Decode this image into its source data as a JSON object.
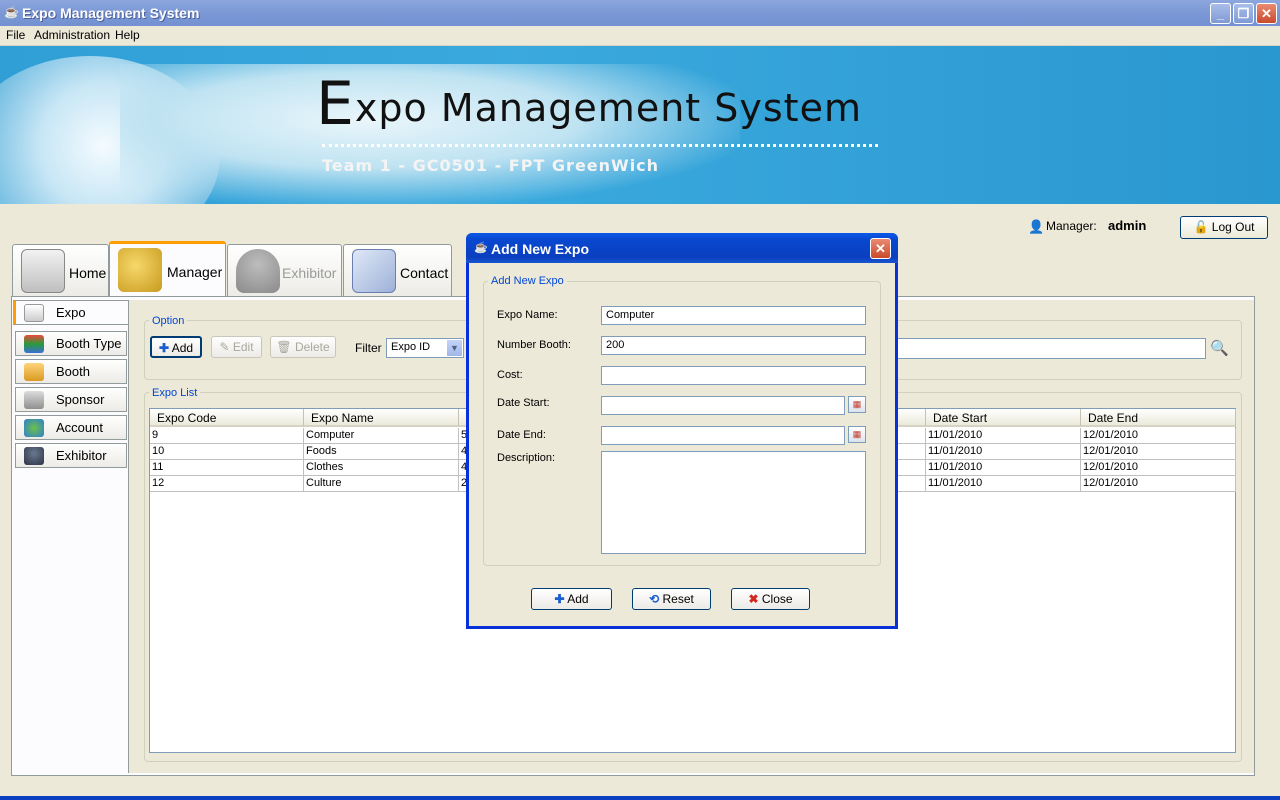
{
  "window": {
    "title": "Expo Management System",
    "minimize": "_",
    "maximize": "❐",
    "close": "✕"
  },
  "menu": {
    "file": "File",
    "administration": "Administration",
    "help": "Help"
  },
  "banner": {
    "title_initial": "E",
    "title_rest": "xpo Management System",
    "subtitle": "Team 1 - GC0501 - FPT GreenWich"
  },
  "user": {
    "role_label": "Manager:",
    "name": "admin",
    "logout": "Log Out"
  },
  "tabs": {
    "home": "Home",
    "manager": "Manager",
    "exhibitor": "Exhibitor",
    "contact": "Contact"
  },
  "sidebar": [
    "Expo",
    "Booth Type",
    "Booth",
    "Sponsor",
    "Account",
    "Exhibitor"
  ],
  "option": {
    "group_label": "Option",
    "add": "Add",
    "edit": "Edit",
    "delete": "Delete",
    "filter_label": "Filter",
    "filter_value": "Expo ID"
  },
  "expo_list": {
    "group_label": "Expo List",
    "columns": [
      "Expo Code",
      "Expo Name",
      "Date Start",
      "Date End"
    ],
    "rows": [
      {
        "code": "9",
        "name": "Computer",
        "partial": "5",
        "start": "11/01/2010",
        "end": "12/01/2010"
      },
      {
        "code": "10",
        "name": "Foods",
        "partial": "4",
        "start": "11/01/2010",
        "end": "12/01/2010"
      },
      {
        "code": "11",
        "name": "Clothes",
        "partial": "4",
        "start": "11/01/2010",
        "end": "12/01/2010"
      },
      {
        "code": "12",
        "name": "Culture",
        "partial": "2",
        "start": "11/01/2010",
        "end": "12/01/2010"
      }
    ]
  },
  "dialog": {
    "title": "Add New Expo",
    "group_label": "Add New Expo",
    "labels": {
      "name": "Expo Name:",
      "booth": "Number Booth:",
      "cost": "Cost:",
      "start": "Date Start:",
      "end": "Date End:",
      "desc": "Description:"
    },
    "values": {
      "name": "Computer",
      "booth": "200",
      "cost": "",
      "start": "",
      "end": "",
      "desc": ""
    },
    "buttons": {
      "add": "Add",
      "reset": "Reset",
      "close": "Close"
    }
  }
}
